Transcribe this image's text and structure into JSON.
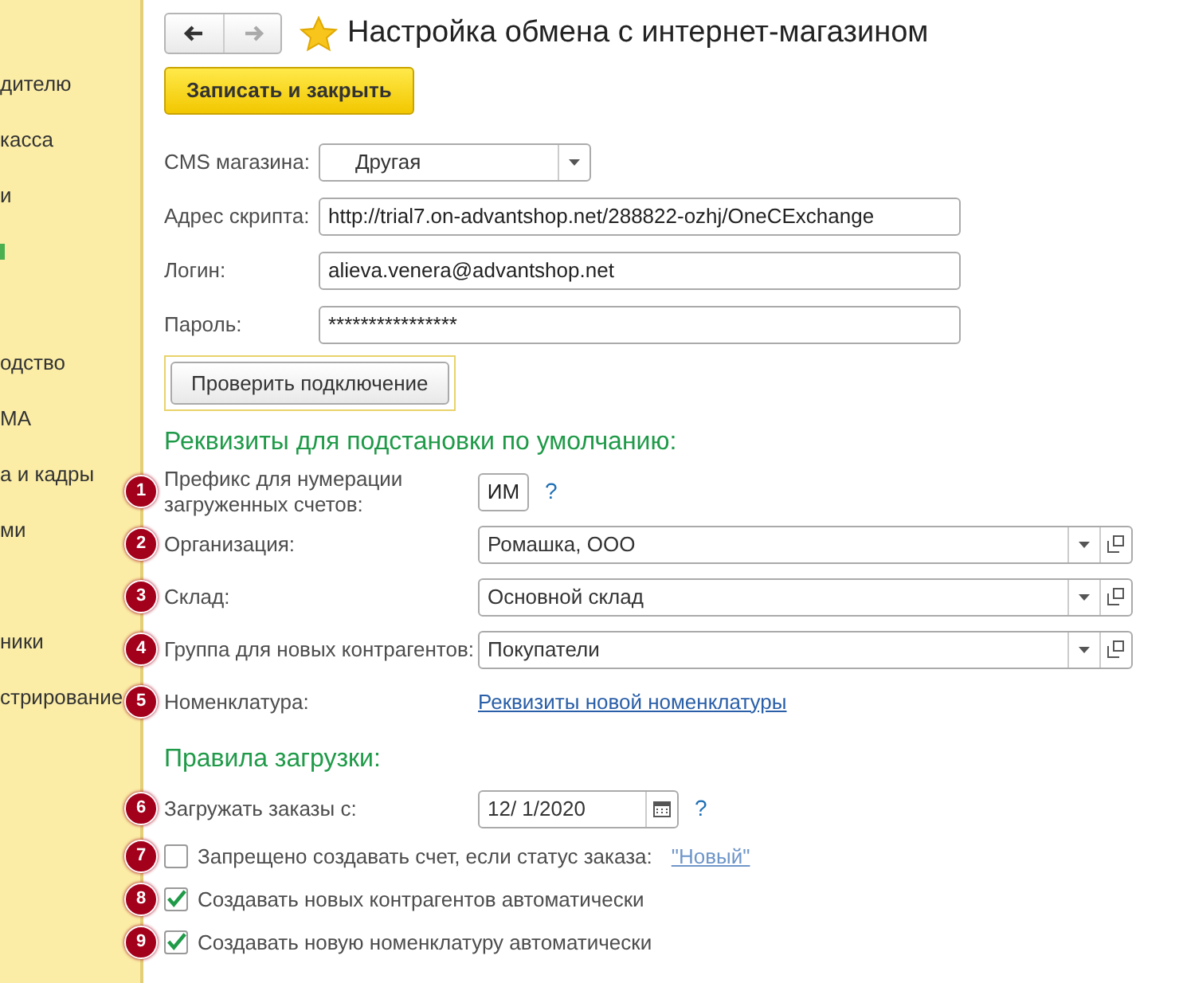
{
  "sidebar": {
    "items": [
      {
        "kind": "text",
        "label": "дителю"
      },
      {
        "kind": "text",
        "label": "касса"
      },
      {
        "kind": "text",
        "label": "и"
      },
      {
        "kind": "active-mark"
      },
      {
        "kind": "gap"
      },
      {
        "kind": "text",
        "label": "одство"
      },
      {
        "kind": "text",
        "label": "МА"
      },
      {
        "kind": "text",
        "label": "а и кадры"
      },
      {
        "kind": "text",
        "label": "ми"
      },
      {
        "kind": "gap"
      },
      {
        "kind": "text",
        "label": "ники"
      },
      {
        "kind": "text",
        "label": "стрирование"
      }
    ]
  },
  "nav_buttons": [
    {
      "kind": "back",
      "disabled": false
    },
    {
      "kind": "forward",
      "disabled": true
    }
  ],
  "title": "Настройка обмена с интернет-магазином",
  "save_button": "Записать и закрыть",
  "connection_fields": [
    {
      "kind": "select",
      "label": "CMS магазина:",
      "value": "Другая"
    },
    {
      "kind": "text",
      "label": "Адрес скрипта:",
      "value": "http://trial7.on-advantshop.net/288822-ozhj/OneCExchange"
    },
    {
      "kind": "text",
      "label": "Логин:",
      "value": "alieva.venera@advantshop.net"
    },
    {
      "kind": "text",
      "label": "Пароль:",
      "value": "****************"
    }
  ],
  "check_button": "Проверить подключение",
  "defaults_section": {
    "title": "Реквизиты для подстановки по умолчанию:",
    "rows": [
      {
        "kind": "short",
        "marker": "1",
        "label": "Префикс для нумерации загруженных счетов:",
        "value": "ИМ",
        "help": "?"
      },
      {
        "kind": "reference",
        "marker": "2",
        "label": "Организация:",
        "value": "Ромашка, ООО"
      },
      {
        "kind": "reference",
        "marker": "3",
        "label": "Склад:",
        "value": "Основной склад"
      },
      {
        "kind": "reference",
        "marker": "4",
        "label": "Группа для новых контрагентов:",
        "value": "Покупатели"
      },
      {
        "kind": "link",
        "marker": "5",
        "label": "Номенклатура:",
        "value": "Реквизиты новой номенклатуры"
      }
    ]
  },
  "rules_section": {
    "title": "Правила загрузки:",
    "rows": [
      {
        "kind": "date",
        "marker": "6",
        "label": "Загружать заказы с:",
        "value": "12/ 1/2020",
        "help": "?"
      },
      {
        "kind": "checkbox",
        "marker": "7",
        "label": "Запрещено создавать счет, если статус заказа:",
        "checked": false,
        "link": "\"Новый\""
      },
      {
        "kind": "checkbox",
        "marker": "8",
        "label": "Создавать новых контрагентов автоматически",
        "checked": true
      },
      {
        "kind": "checkbox",
        "marker": "9",
        "label": "Создавать новую номенклатуру автоматически",
        "checked": true
      }
    ]
  }
}
